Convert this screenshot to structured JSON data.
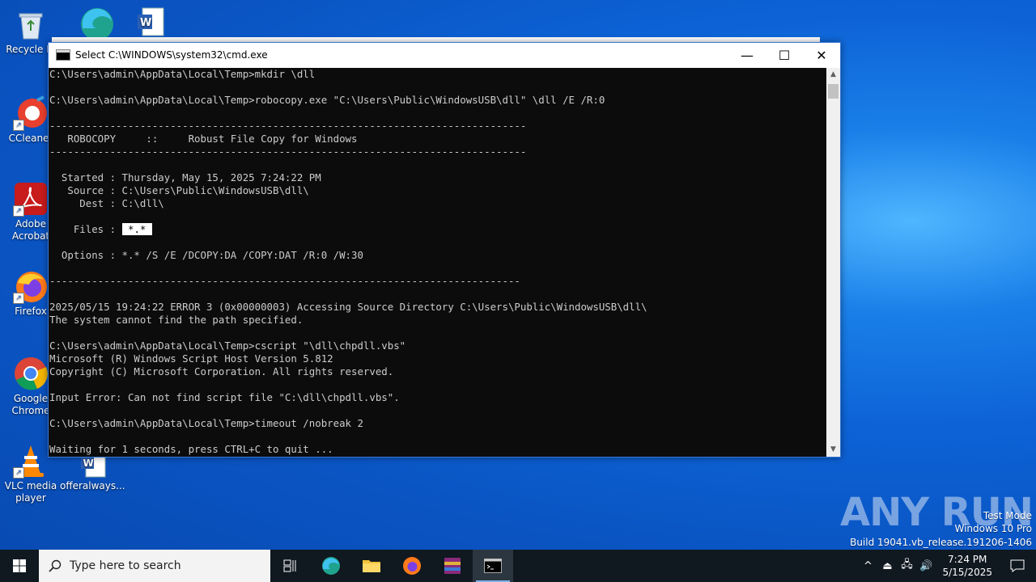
{
  "desktop": {
    "icons": [
      {
        "label": "Recycle Bi"
      },
      {
        "label": "CCleaner"
      },
      {
        "label": "Adobe Acrobat"
      },
      {
        "label": "Firefox"
      },
      {
        "label": "Google Chrome"
      },
      {
        "label": "VLC media player"
      },
      {
        "label": "offeralways..."
      }
    ]
  },
  "window": {
    "title": "Select C:\\WINDOWS\\system32\\cmd.exe",
    "minimize": "—",
    "maximize": "☐",
    "close": "✕"
  },
  "console": {
    "lines": [
      "C:\\Users\\admin\\AppData\\Local\\Temp>mkdir \\dll",
      "",
      "C:\\Users\\admin\\AppData\\Local\\Temp>robocopy.exe \"C:\\Users\\Public\\WindowsUSB\\dll\" \\dll /E /R:0",
      "",
      "-------------------------------------------------------------------------------",
      "   ROBOCOPY     ::     Robust File Copy for Windows",
      "-------------------------------------------------------------------------------",
      "",
      "  Started : Thursday, May 15, 2025 7:24:22 PM",
      "   Source : C:\\Users\\Public\\WindowsUSB\\dll\\",
      "     Dest : C:\\dll\\",
      "",
      "    Files : ",
      "",
      "  Options : *.* /S /E /DCOPY:DA /COPY:DAT /R:0 /W:30",
      "",
      "------------------------------------------------------------------------------",
      "",
      "2025/05/15 19:24:22 ERROR 3 (0x00000003) Accessing Source Directory C:\\Users\\Public\\WindowsUSB\\dll\\",
      "The system cannot find the path specified.",
      "",
      "C:\\Users\\admin\\AppData\\Local\\Temp>cscript \"\\dll\\chpdll.vbs\"",
      "Microsoft (R) Windows Script Host Version 5.812",
      "Copyright (C) Microsoft Corporation. All rights reserved.",
      "",
      "Input Error: Can not find script file \"C:\\dll\\chpdll.vbs\".",
      "",
      "C:\\Users\\admin\\AppData\\Local\\Temp>timeout /nobreak 2",
      "",
      "Waiting for 1 seconds, press CTRL+C to quit ..."
    ],
    "selected_files_text": "*.*"
  },
  "taskbar": {
    "search_placeholder": "Type here to search",
    "clock_time": "7:24 PM",
    "clock_date": "5/15/2025"
  },
  "watermark": {
    "brand": "ANY RUN",
    "line1": "Test Mode",
    "line2": "Windows 10 Pro",
    "line3": "Build 19041.vb_release.191206-1406"
  },
  "colors": {
    "desktop_accent": "#0d63d6",
    "console_bg": "#0c0c0c",
    "console_text": "#cccccc",
    "taskbar_bg": "#101820"
  }
}
